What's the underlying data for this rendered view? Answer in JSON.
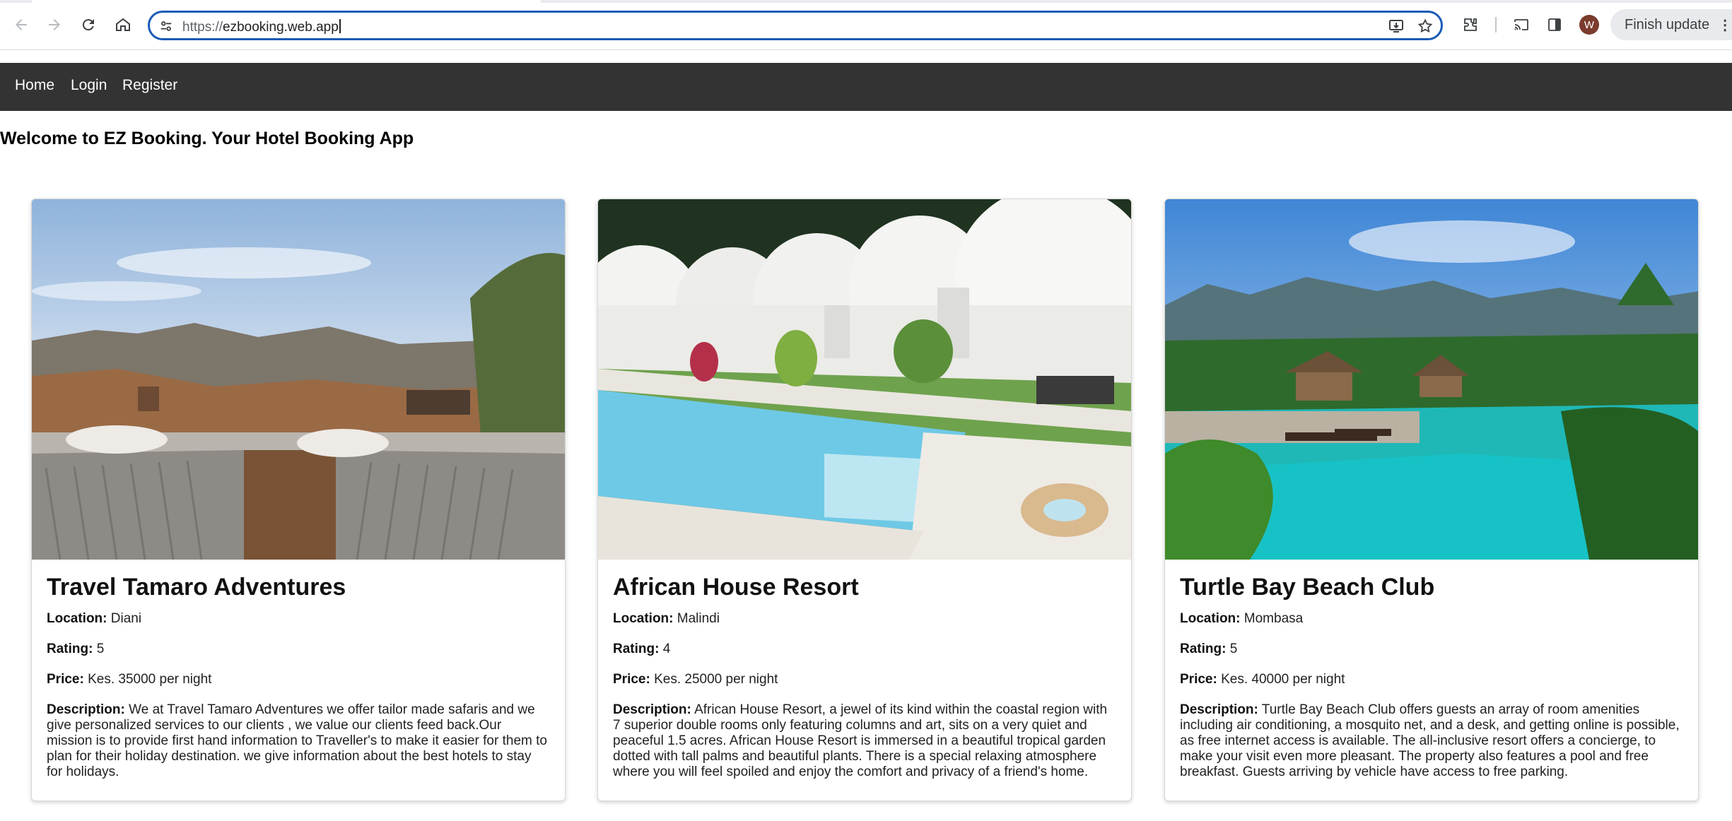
{
  "browser": {
    "url_scheme": "https://",
    "url_host": "ezbooking.web.app",
    "update_label": "Finish update",
    "profile_initial": "W",
    "accent_color": "#1a5bb8"
  },
  "nav": {
    "background": "#333333",
    "links": [
      "Home",
      "Login",
      "Register"
    ]
  },
  "page": {
    "welcome": "Welcome to EZ Booking. Your Hotel Booking App"
  },
  "labels": {
    "location": "Location:",
    "rating": "Rating:",
    "price": "Price:",
    "description": "Description:"
  },
  "hotels": [
    {
      "name": "Travel Tamaro Adventures",
      "location": "Diani",
      "rating": "5",
      "price": "Kes. 35000 per night",
      "description": "We at Travel Tamaro Adventures we offer tailor made safaris and we give personalized services to our clients , we value our clients feed back.Our mission is to provide first hand information to Traveller's to make it easier for them to plan for their holiday destination. we give information about the best hotels to stay for holidays.",
      "image": "sunbeds-mountain-sunset"
    },
    {
      "name": "African House Resort",
      "location": "Malindi",
      "rating": "4",
      "price": "Kes. 25000 per night",
      "description": "African House Resort, a jewel of its kind within the coastal region with 7 superior double rooms only featuring columns and art, sits on a very quiet and peaceful 1.5 acres. African House Resort is immersed in a beautiful tropical garden dotted with tall palms and beautiful plants. There is a special relaxing atmosphere where you will feel spoiled and enjoy the comfort and privacy of a friend's home.",
      "image": "dome-houses-pool"
    },
    {
      "name": "Turtle Bay Beach Club",
      "location": "Mombasa",
      "rating": "5",
      "price": "Kes. 40000 per night",
      "description": "Turtle Bay Beach Club offers guests an array of room amenities including air conditioning, a mosquito net, and a desk, and getting online is possible, as free internet access is available. The all-inclusive resort offers a concierge, to make your visit even more pleasant. The property also features a pool and free breakfast. Guests arriving by vehicle have access to free parking.",
      "image": "tropical-pool-palms"
    }
  ]
}
